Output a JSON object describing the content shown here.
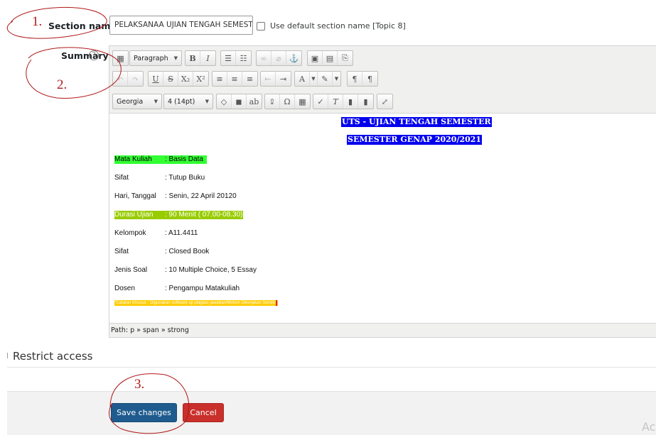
{
  "section": {
    "label": "Section name",
    "value": "PELAKSANAA UJIAN TENGAH SEMESTER",
    "default_checkbox_label": "Use default section name [Topic 8]"
  },
  "summary": {
    "label": "Summary",
    "help_glyph": "?"
  },
  "toolbar": {
    "format_select": "Paragraph",
    "font_select": "Georgia",
    "size_select": "4 (14pt)",
    "icons_row1": [
      "grid-icon",
      "bold-icon",
      "italic-icon",
      "bullet-list-icon",
      "numbered-list-icon",
      "link-icon",
      "unlink-icon",
      "anchor-icon",
      "image-icon",
      "media-icon",
      "paste-icon"
    ],
    "icons_row2": [
      "undo-icon",
      "redo-icon",
      "underline-icon",
      "strikethrough-icon",
      "subscript-icon",
      "superscript-icon",
      "align-left-icon",
      "align-center-icon",
      "align-right-icon",
      "outdent-icon",
      "indent-icon",
      "text-color-icon",
      "background-color-icon",
      "ltr-icon",
      "rtl-icon"
    ],
    "icons_row3": [
      "code-icon",
      "find-icon",
      "replace-icon",
      "upload-icon",
      "special-char-icon",
      "table-icon",
      "clean-icon",
      "clear-format-icon",
      "paste-text-icon",
      "paste-word-icon",
      "fullscreen-icon"
    ]
  },
  "content": {
    "heading1": "UTS - UJIAN TENGAH SEMESTER",
    "heading2": "SEMESTER GENAP 2020/2021",
    "rows": [
      {
        "key": "Mata Kuliah",
        "value": ": Basis Data"
      },
      {
        "key": "Sifat",
        "value": ": Tutup Buku"
      },
      {
        "key": "Hari, Tanggal",
        "value": ": Senin, 22 April 20120"
      },
      {
        "key": "Durasi Ujian",
        "value": ": 90 Menit ( 07.00-08.30)"
      },
      {
        "key": "Kelompok",
        "value": ": A11.4411"
      },
      {
        "key": "Sifat",
        "value": ": Closed Book"
      },
      {
        "key": "Jenis Soal",
        "value": ": 10 Multiple Choice, 5 Essay"
      },
      {
        "key": "Dosen",
        "value": ": Pengampu Matakuliah"
      }
    ],
    "note": "*Catatan Khusus : Digunakan software uji plagiasi jawaban/Mohon Dikerjakan Sendiri"
  },
  "path": "Path: p » span » strong",
  "restrict": {
    "title": "Restrict access"
  },
  "buttons": {
    "save": "Save changes",
    "cancel": "Cancel"
  },
  "annotations": {
    "one": "1.",
    "two": "2.",
    "three": "3."
  },
  "watermark": "Ac",
  "colors": {
    "heading_bg": "#0000ee",
    "green_highlight": "#33ff33",
    "olive_highlight": "#99cc00",
    "note_bg": "#ffcc00",
    "save_btn": "#1f5b8e",
    "cancel_btn": "#c9302c",
    "annotation": "#b01818"
  }
}
